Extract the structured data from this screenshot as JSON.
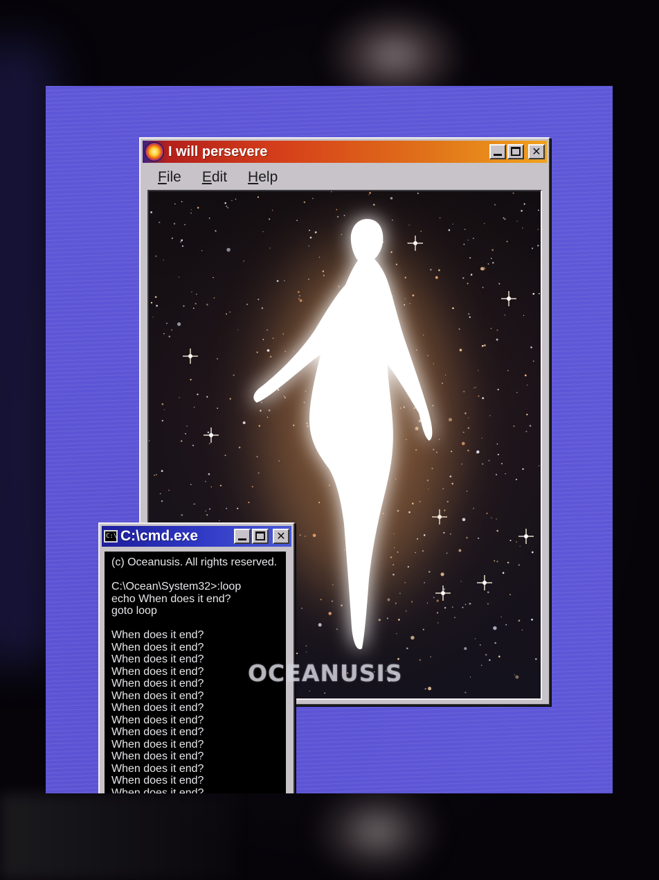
{
  "main_window": {
    "title": "I will persevere",
    "menu": [
      {
        "label": "File",
        "accel": "F",
        "rest": "ile"
      },
      {
        "label": "Edit",
        "accel": "E",
        "rest": "dit"
      },
      {
        "label": "Help",
        "accel": "H",
        "rest": "elp"
      }
    ],
    "minimize_icon": "minimize-icon",
    "maximize_icon": "maximize-icon",
    "close_icon": "close-icon",
    "app_icon": "sun-orb-icon"
  },
  "cmd_window": {
    "title": "C:\\cmd.exe",
    "icon_label": "C:\\",
    "lines": [
      "(c) Oceanusis. All rights reserved.",
      "",
      "C:\\Ocean\\System32>:loop",
      "echo When does it end?",
      "goto loop",
      "",
      "When does it end?",
      "When does it end?",
      "When does it end?",
      "When does it end?",
      "When does it end?",
      "When does it end?",
      "When does it end?",
      "When does it end?",
      "When does it end?",
      "When does it end?",
      "When does it end?",
      "When does it end?",
      "When does it end?",
      "When does it end?"
    ]
  },
  "watermark": "OCEANUSIS",
  "colors": {
    "panel": "#5e58d8",
    "main_titlebar": "#d6401a",
    "cmd_titlebar": "#2f38c4",
    "window_face": "#c7c3c8"
  }
}
